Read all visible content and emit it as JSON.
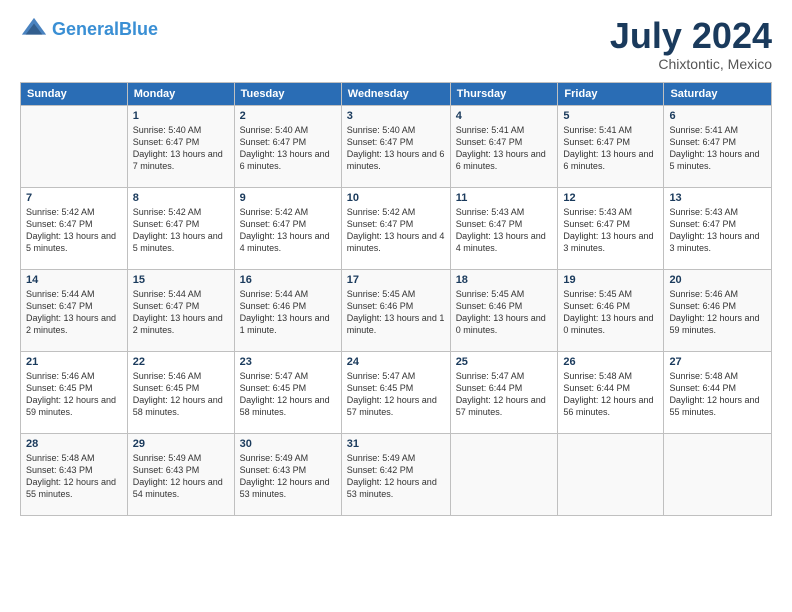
{
  "header": {
    "logo_line1": "General",
    "logo_line2": "Blue",
    "month_title": "July 2024",
    "location": "Chixtontic, Mexico"
  },
  "weekdays": [
    "Sunday",
    "Monday",
    "Tuesday",
    "Wednesday",
    "Thursday",
    "Friday",
    "Saturday"
  ],
  "weeks": [
    [
      {
        "day": "",
        "sunrise": "",
        "sunset": "",
        "daylight": ""
      },
      {
        "day": "1",
        "sunrise": "Sunrise: 5:40 AM",
        "sunset": "Sunset: 6:47 PM",
        "daylight": "Daylight: 13 hours and 7 minutes."
      },
      {
        "day": "2",
        "sunrise": "Sunrise: 5:40 AM",
        "sunset": "Sunset: 6:47 PM",
        "daylight": "Daylight: 13 hours and 6 minutes."
      },
      {
        "day": "3",
        "sunrise": "Sunrise: 5:40 AM",
        "sunset": "Sunset: 6:47 PM",
        "daylight": "Daylight: 13 hours and 6 minutes."
      },
      {
        "day": "4",
        "sunrise": "Sunrise: 5:41 AM",
        "sunset": "Sunset: 6:47 PM",
        "daylight": "Daylight: 13 hours and 6 minutes."
      },
      {
        "day": "5",
        "sunrise": "Sunrise: 5:41 AM",
        "sunset": "Sunset: 6:47 PM",
        "daylight": "Daylight: 13 hours and 6 minutes."
      },
      {
        "day": "6",
        "sunrise": "Sunrise: 5:41 AM",
        "sunset": "Sunset: 6:47 PM",
        "daylight": "Daylight: 13 hours and 5 minutes."
      }
    ],
    [
      {
        "day": "7",
        "sunrise": "Sunrise: 5:42 AM",
        "sunset": "Sunset: 6:47 PM",
        "daylight": "Daylight: 13 hours and 5 minutes."
      },
      {
        "day": "8",
        "sunrise": "Sunrise: 5:42 AM",
        "sunset": "Sunset: 6:47 PM",
        "daylight": "Daylight: 13 hours and 5 minutes."
      },
      {
        "day": "9",
        "sunrise": "Sunrise: 5:42 AM",
        "sunset": "Sunset: 6:47 PM",
        "daylight": "Daylight: 13 hours and 4 minutes."
      },
      {
        "day": "10",
        "sunrise": "Sunrise: 5:42 AM",
        "sunset": "Sunset: 6:47 PM",
        "daylight": "Daylight: 13 hours and 4 minutes."
      },
      {
        "day": "11",
        "sunrise": "Sunrise: 5:43 AM",
        "sunset": "Sunset: 6:47 PM",
        "daylight": "Daylight: 13 hours and 4 minutes."
      },
      {
        "day": "12",
        "sunrise": "Sunrise: 5:43 AM",
        "sunset": "Sunset: 6:47 PM",
        "daylight": "Daylight: 13 hours and 3 minutes."
      },
      {
        "day": "13",
        "sunrise": "Sunrise: 5:43 AM",
        "sunset": "Sunset: 6:47 PM",
        "daylight": "Daylight: 13 hours and 3 minutes."
      }
    ],
    [
      {
        "day": "14",
        "sunrise": "Sunrise: 5:44 AM",
        "sunset": "Sunset: 6:47 PM",
        "daylight": "Daylight: 13 hours and 2 minutes."
      },
      {
        "day": "15",
        "sunrise": "Sunrise: 5:44 AM",
        "sunset": "Sunset: 6:47 PM",
        "daylight": "Daylight: 13 hours and 2 minutes."
      },
      {
        "day": "16",
        "sunrise": "Sunrise: 5:44 AM",
        "sunset": "Sunset: 6:46 PM",
        "daylight": "Daylight: 13 hours and 1 minute."
      },
      {
        "day": "17",
        "sunrise": "Sunrise: 5:45 AM",
        "sunset": "Sunset: 6:46 PM",
        "daylight": "Daylight: 13 hours and 1 minute."
      },
      {
        "day": "18",
        "sunrise": "Sunrise: 5:45 AM",
        "sunset": "Sunset: 6:46 PM",
        "daylight": "Daylight: 13 hours and 0 minutes."
      },
      {
        "day": "19",
        "sunrise": "Sunrise: 5:45 AM",
        "sunset": "Sunset: 6:46 PM",
        "daylight": "Daylight: 13 hours and 0 minutes."
      },
      {
        "day": "20",
        "sunrise": "Sunrise: 5:46 AM",
        "sunset": "Sunset: 6:46 PM",
        "daylight": "Daylight: 12 hours and 59 minutes."
      }
    ],
    [
      {
        "day": "21",
        "sunrise": "Sunrise: 5:46 AM",
        "sunset": "Sunset: 6:45 PM",
        "daylight": "Daylight: 12 hours and 59 minutes."
      },
      {
        "day": "22",
        "sunrise": "Sunrise: 5:46 AM",
        "sunset": "Sunset: 6:45 PM",
        "daylight": "Daylight: 12 hours and 58 minutes."
      },
      {
        "day": "23",
        "sunrise": "Sunrise: 5:47 AM",
        "sunset": "Sunset: 6:45 PM",
        "daylight": "Daylight: 12 hours and 58 minutes."
      },
      {
        "day": "24",
        "sunrise": "Sunrise: 5:47 AM",
        "sunset": "Sunset: 6:45 PM",
        "daylight": "Daylight: 12 hours and 57 minutes."
      },
      {
        "day": "25",
        "sunrise": "Sunrise: 5:47 AM",
        "sunset": "Sunset: 6:44 PM",
        "daylight": "Daylight: 12 hours and 57 minutes."
      },
      {
        "day": "26",
        "sunrise": "Sunrise: 5:48 AM",
        "sunset": "Sunset: 6:44 PM",
        "daylight": "Daylight: 12 hours and 56 minutes."
      },
      {
        "day": "27",
        "sunrise": "Sunrise: 5:48 AM",
        "sunset": "Sunset: 6:44 PM",
        "daylight": "Daylight: 12 hours and 55 minutes."
      }
    ],
    [
      {
        "day": "28",
        "sunrise": "Sunrise: 5:48 AM",
        "sunset": "Sunset: 6:43 PM",
        "daylight": "Daylight: 12 hours and 55 minutes."
      },
      {
        "day": "29",
        "sunrise": "Sunrise: 5:49 AM",
        "sunset": "Sunset: 6:43 PM",
        "daylight": "Daylight: 12 hours and 54 minutes."
      },
      {
        "day": "30",
        "sunrise": "Sunrise: 5:49 AM",
        "sunset": "Sunset: 6:43 PM",
        "daylight": "Daylight: 12 hours and 53 minutes."
      },
      {
        "day": "31",
        "sunrise": "Sunrise: 5:49 AM",
        "sunset": "Sunset: 6:42 PM",
        "daylight": "Daylight: 12 hours and 53 minutes."
      },
      {
        "day": "",
        "sunrise": "",
        "sunset": "",
        "daylight": ""
      },
      {
        "day": "",
        "sunrise": "",
        "sunset": "",
        "daylight": ""
      },
      {
        "day": "",
        "sunrise": "",
        "sunset": "",
        "daylight": ""
      }
    ]
  ]
}
